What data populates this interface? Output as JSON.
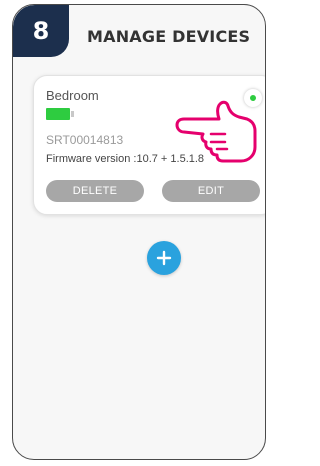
{
  "step_badge": "8",
  "title": "MANAGE DEVICES",
  "device": {
    "name": "Bedroom",
    "serial": "SRT00014813",
    "firmware": "Firmware version :10.7 + 1.5.1.8",
    "battery_level": 1.0,
    "online": true,
    "delete_label": "DELETE",
    "edit_label": "EDIT"
  },
  "icons": {
    "hand": "pointing-hand-icon",
    "add": "plus-icon",
    "battery": "battery-icon",
    "status": "status-dot-icon"
  },
  "colors": {
    "badge": "#1c2f4d",
    "battery": "#2ecc40",
    "status_online": "#2ecc40",
    "button": "#a7a7a7",
    "add_button": "#2aa2de",
    "hand_outline": "#e5006d"
  }
}
